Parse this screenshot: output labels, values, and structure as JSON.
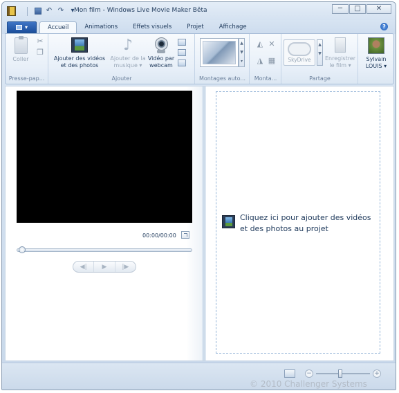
{
  "window": {
    "title": "Mon film - Windows Live Movie Maker Bêta",
    "controls": {
      "minimize": "─",
      "maximize": "□",
      "close": "✕"
    }
  },
  "quick_access": {
    "undo": "↶",
    "redo": "↷",
    "customize": "▾"
  },
  "ribbon_tabs": {
    "file_arrow": "▾",
    "items": [
      {
        "label": "Accueil",
        "active": true
      },
      {
        "label": "Animations",
        "active": false
      },
      {
        "label": "Effets visuels",
        "active": false
      },
      {
        "label": "Projet",
        "active": false
      },
      {
        "label": "Affichage",
        "active": false
      }
    ],
    "help": "?"
  },
  "ribbon": {
    "clipboard": {
      "label": "Presse-pap...",
      "paste": "Coller",
      "cut_icon": "✂",
      "copy_icon": "❐"
    },
    "add": {
      "label": "Ajouter",
      "add_media_line1": "Ajouter des vidéos",
      "add_media_line2": "et des photos",
      "add_music_line1": "Ajouter de la",
      "add_music_line2": "musique",
      "add_music_arrow": "▾",
      "webcam_line1": "Vidéo par",
      "webcam_line2": "webcam",
      "note_icon": "♪"
    },
    "automovie": {
      "label": "Montages auto...",
      "scroll_up": "▲",
      "scroll_down": "▼",
      "more": "▾"
    },
    "edit": {
      "label": "Monta...",
      "rotate_left": "◭",
      "rotate_right": "◮",
      "remove": "✕",
      "select_all": "▦"
    },
    "share": {
      "label": "Partage",
      "skydrive": "SkyDrive",
      "save_line1": "Enregistrer",
      "save_line2": "le film",
      "save_arrow": "▾"
    },
    "account": {
      "line1": "Sylvain",
      "line2": "LOUIS",
      "arrow": "▾"
    }
  },
  "player": {
    "time": "00:00/00:00",
    "prev": "◀|",
    "play": "▶",
    "next": "|▶"
  },
  "storyboard": {
    "prompt": "Cliquez ici pour ajouter des vidéos et des photos au projet"
  },
  "statusbar": {
    "zoom_minus": "−",
    "zoom_plus": "+",
    "watermark": "© 2010 Challenger Systems"
  },
  "colors": {
    "frame": "#c8d8ea",
    "text": "#1e395b",
    "file_button": "#1c4f9c",
    "preview_bg": "#000000",
    "drop_border": "#92b3d7"
  }
}
